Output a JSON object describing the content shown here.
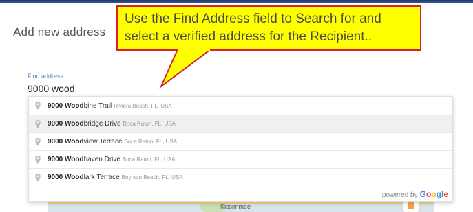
{
  "dialog": {
    "title": "Add new address"
  },
  "callout": {
    "text": "Use the Find Address field to Search for and select a verified address for the Recipient.."
  },
  "find_address": {
    "label": "Find address",
    "value": "9000 wood"
  },
  "suggestions": [
    {
      "match": "9000 Wood",
      "rest": "bine Trail",
      "secondary": "Riviera Beach, FL, USA"
    },
    {
      "match": "9000 Wood",
      "rest": "bridge Drive",
      "secondary": "Boca Raton, FL, USA"
    },
    {
      "match": "9000 Wood",
      "rest": "view Terrace",
      "secondary": "Boca Raton, FL, USA"
    },
    {
      "match": "9000 Wood",
      "rest": "haven Drive",
      "secondary": "Boca Raton, FL, USA"
    },
    {
      "match": "9000 Wood",
      "rest": "lark Terrace",
      "secondary": "Boynton Beach, FL, USA"
    }
  ],
  "powered_by": {
    "text": "powered by",
    "brand": "Google"
  },
  "map": {
    "place_label": "Kissimmee"
  },
  "colors": {
    "callout_fill": "#ffff00",
    "callout_border": "#d9202a",
    "label_blue": "#4a82c7"
  }
}
